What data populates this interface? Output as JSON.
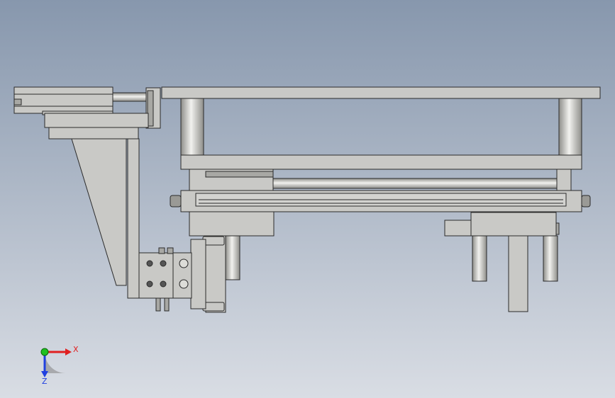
{
  "viewport": {
    "background_top": "#8797ad",
    "background_bottom": "#d9dde4"
  },
  "colors": {
    "metal": "#c9c9c6",
    "metal_dark": "#a8a8a4",
    "outline": "#2a2a2a",
    "rod_light": "#f2f2ef",
    "rod_dark": "#8e8e8a",
    "axis_x": "#e02020",
    "axis_y": "#20c020",
    "axis_z": "#2040e0"
  },
  "triad": {
    "x_label": "X",
    "z_label": "Z",
    "x_icon": "x-axis-arrow-icon",
    "y_icon": "y-axis-dot-icon",
    "z_icon": "z-axis-arrow-icon"
  }
}
